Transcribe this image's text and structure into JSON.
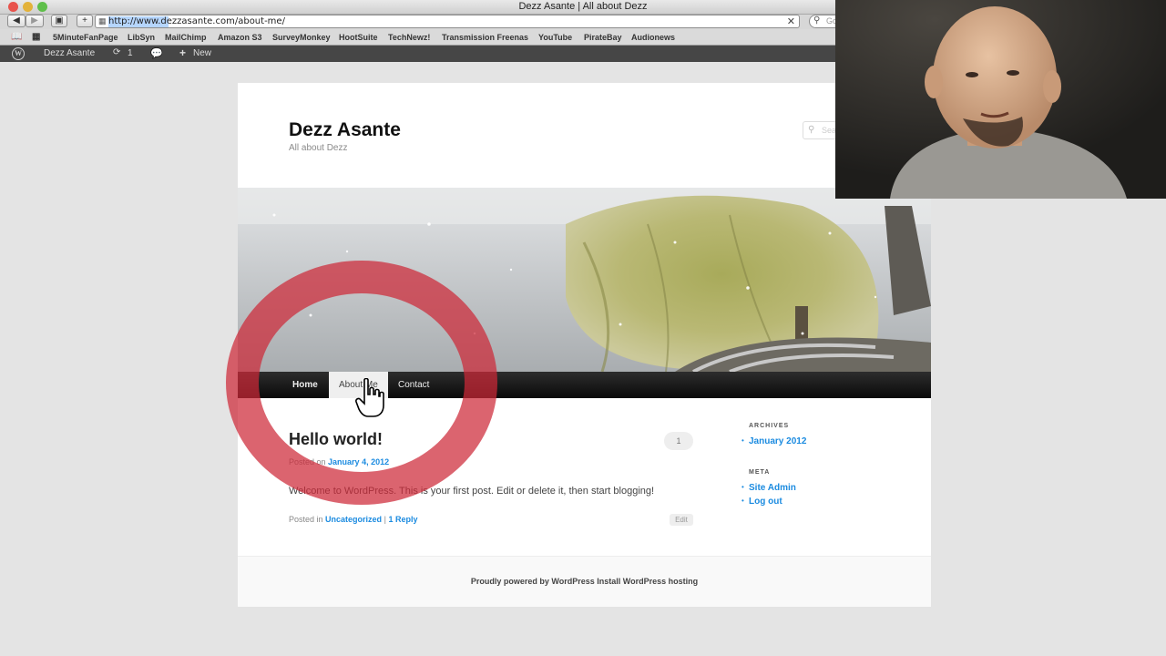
{
  "browser": {
    "window_title": "Dezz Asante | All about Dezz",
    "url": "http://www.dezzasante.com/about-me/",
    "search_placeholder": "Go",
    "bookmarks": [
      "5MinuteFanPage",
      "LibSyn",
      "MailChimp",
      "Amazon S3",
      "SurveyMonkey",
      "HootSuite",
      "TechNewz!",
      "Transmission Freenas",
      "YouTube",
      "PirateBay",
      "Audionews"
    ]
  },
  "admin_bar": {
    "site_name": "Dezz Asante",
    "updates_count": "1",
    "new_label": "New"
  },
  "site": {
    "title": "Dezz Asante",
    "description": "All about Dezz",
    "search_placeholder": "Search"
  },
  "nav": {
    "items": [
      "Home",
      "About Me",
      "Contact"
    ],
    "active": "About Me"
  },
  "post": {
    "title": "Hello world!",
    "comment_count": "1",
    "posted_on_label": "Posted on",
    "date": "January 4, 2012",
    "body": "Welcome to WordPress. This is your first post. Edit or delete it, then start blogging!",
    "posted_in_label": "Posted in",
    "category": "Uncategorized",
    "separator": "|",
    "reply_label": "1 Reply",
    "edit_label": "Edit"
  },
  "sidebar": {
    "archives_title": "ARCHIVES",
    "archives": [
      "January 2012"
    ],
    "meta_title": "META",
    "meta_links": [
      "Site Admin",
      "Log out"
    ]
  },
  "footer": {
    "text": "Proudly powered by WordPress Install WordPress hosting"
  },
  "colors": {
    "link": "#1b8be0",
    "highlight_circle": "#cd2837",
    "admin_bar": "#464646"
  }
}
